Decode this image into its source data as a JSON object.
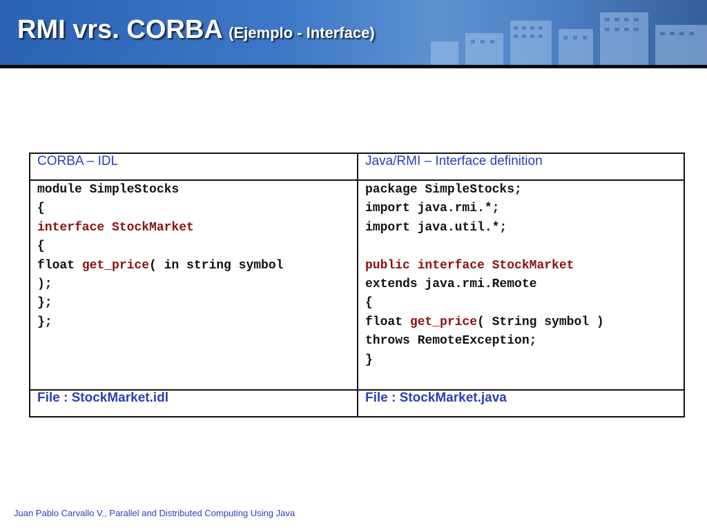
{
  "slide": {
    "title_main": "RMI vrs. CORBA",
    "title_sub": "(Ejemplo - Interface)",
    "footer": "Juan Pablo Carvallo V., Parallel and Distributed Computing Using Java"
  },
  "table": {
    "headers": [
      "CORBA – IDL",
      "Java/RMI – Interface definition"
    ],
    "idl_code": {
      "l1": "module SimpleStocks",
      "l2": "{",
      "l3_kw": "interface StockMarket",
      "l4": "{",
      "l5_a": "float ",
      "l5_kw": "get_price",
      "l5_b": "( in string symbol",
      "l6": ");",
      "l7": "};",
      "l8": "};"
    },
    "java_code": {
      "l1": "package SimpleStocks;",
      "l2": "import java.rmi.*;",
      "l3": "import java.util.*;",
      "l5_kw": "public interface StockMarket",
      "l6": "extends java.rmi.Remote",
      "l7": "{",
      "l8_a": "float ",
      "l8_kw": "get_price",
      "l8_b": "( String symbol )",
      "l9": "throws RemoteException;",
      "l10": "}"
    },
    "files": [
      "File : StockMarket.idl",
      "File : StockMarket.java"
    ]
  }
}
